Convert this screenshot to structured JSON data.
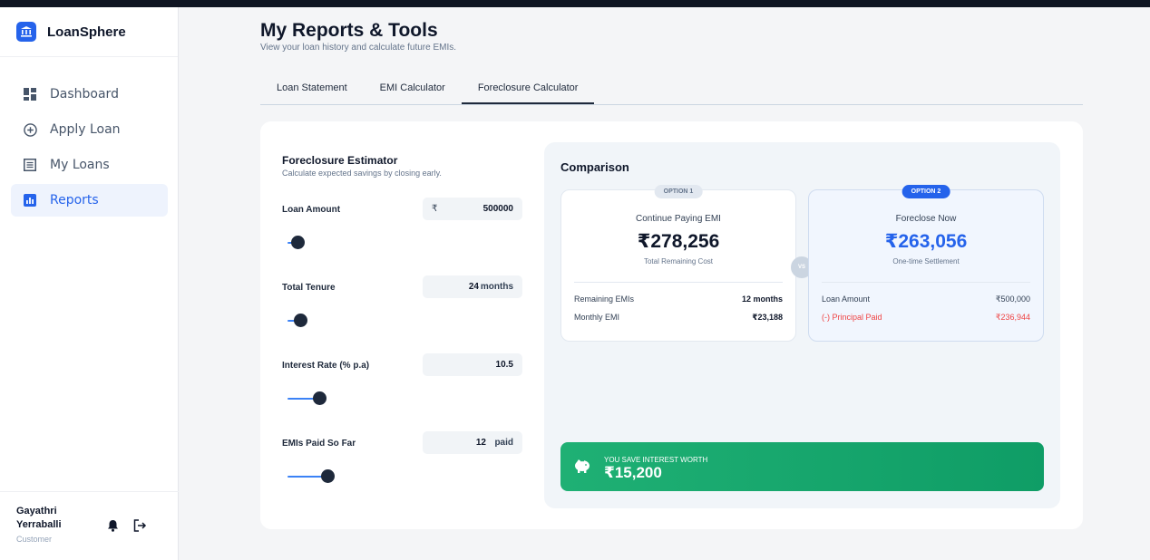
{
  "colors": {
    "accent": "#2563eb",
    "success": "#10a36b",
    "danger": "#ef4444",
    "frame": "#0f1522"
  },
  "brand": {
    "name": "LoanSphere",
    "logo_icon": "bank-icon"
  },
  "sidebar": {
    "items": [
      {
        "label": "Dashboard",
        "icon": "dashboard-icon",
        "active": false
      },
      {
        "label": "Apply Loan",
        "icon": "plus-circle-icon",
        "active": false
      },
      {
        "label": "My Loans",
        "icon": "list-icon",
        "active": false
      },
      {
        "label": "Reports",
        "icon": "chart-icon",
        "active": true
      }
    ]
  },
  "user": {
    "name": "Gayathri Yerraballi",
    "role": "Customer"
  },
  "header": {
    "title": "My Reports & Tools",
    "subtitle": "View your loan history and calculate future EMIs."
  },
  "tabs": [
    {
      "label": "Loan Statement",
      "active": false
    },
    {
      "label": "EMI Calculator",
      "active": false
    },
    {
      "label": "Foreclosure Calculator",
      "active": true
    }
  ],
  "estimator": {
    "title": "Foreclosure Estimator",
    "subtitle": "Calculate expected savings by closing early.",
    "fields": {
      "loan_amount": {
        "label": "Loan Amount",
        "prefix": "₹",
        "value": "500000",
        "slider_fraction": 0.08
      },
      "tenure": {
        "label": "Total Tenure",
        "value": "24",
        "unit": "months",
        "slider_fraction": 0.1
      },
      "interest": {
        "label": "Interest Rate (% p.a)",
        "value": "10.5",
        "slider_fraction": 0.24
      },
      "emis_paid": {
        "label": "EMIs Paid So Far",
        "value": "12",
        "unit": "paid",
        "slider_fraction": 0.3
      }
    }
  },
  "comparison": {
    "title": "Comparison",
    "vs_label": "VS",
    "option1": {
      "badge": "OPTION 1",
      "heading": "Continue Paying EMI",
      "amount": "₹278,256",
      "caption": "Total Remaining Cost",
      "rows": [
        {
          "label": "Remaining EMIs",
          "value": "12 months"
        },
        {
          "label": "Monthly EMI",
          "value": "₹23,188"
        }
      ]
    },
    "option2": {
      "badge": "OPTION 2",
      "heading": "Foreclose Now",
      "amount": "₹263,056",
      "caption": "One-time Settlement",
      "rows": [
        {
          "label": "Loan Amount",
          "value": "₹500,000"
        },
        {
          "label": "(-) Principal Paid",
          "value": "₹236,944"
        }
      ]
    },
    "savings": {
      "label": "YOU SAVE INTEREST WORTH",
      "amount": "₹15,200",
      "icon": "piggy-bank-icon"
    }
  }
}
